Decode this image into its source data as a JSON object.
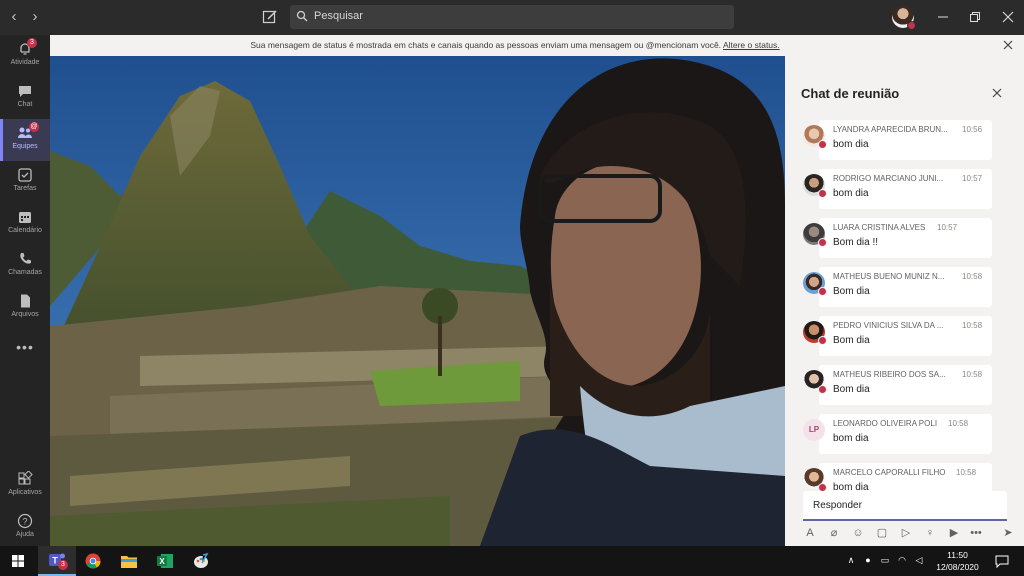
{
  "search": {
    "placeholder": "Pesquisar"
  },
  "rail": [
    {
      "label": "Atividade",
      "icon": "bell-icon",
      "badge": "3"
    },
    {
      "label": "Chat",
      "icon": "chat-icon",
      "badge": ""
    },
    {
      "label": "Equipes",
      "icon": "teams-icon",
      "badge": "@"
    },
    {
      "label": "Tarefas",
      "icon": "tasks-icon",
      "badge": ""
    },
    {
      "label": "Calendário",
      "icon": "calendar-icon",
      "badge": ""
    },
    {
      "label": "Chamadas",
      "icon": "phone-icon",
      "badge": ""
    },
    {
      "label": "Arquivos",
      "icon": "file-icon",
      "badge": ""
    }
  ],
  "rail_bottom": [
    {
      "label": "Aplicativos",
      "icon": "apps-icon"
    },
    {
      "label": "Ajuda",
      "icon": "help-icon"
    }
  ],
  "banner": {
    "message": "Sua mensagem de status é mostrada em chats e canais quando as pessoas enviam uma mensagem ou @mencionam você.",
    "link": "Altere o status."
  },
  "chat": {
    "title": "Chat de reunião",
    "messages": [
      {
        "name": "LYANDRA APARECIDA BRUN...",
        "time": "10:56",
        "text": "bom dia",
        "avatar": "photo"
      },
      {
        "name": "RODRIGO MARCIANO JUNI...",
        "time": "10:57",
        "text": "bom dia",
        "avatar": "photo"
      },
      {
        "name": "LUARA CRISTINA ALVES",
        "time": "10:57",
        "text": "Bom dia !!",
        "avatar": "photo"
      },
      {
        "name": "MATHEUS BUENO MUNIZ N...",
        "time": "10:58",
        "text": "Bom dia",
        "avatar": "photo"
      },
      {
        "name": "PEDRO VINICIUS SILVA DA ...",
        "time": "10:58",
        "text": "Bom dia",
        "avatar": "photo"
      },
      {
        "name": "MATHEUS RIBEIRO DOS SA...",
        "time": "10:58",
        "text": "Bom dia",
        "avatar": "photo"
      },
      {
        "name": "LEONARDO OLIVEIRA POLI",
        "time": "10:58",
        "text": "bom dia",
        "avatar": "initials",
        "initials": "LP"
      },
      {
        "name": "MARCELO CAPORALLI FILHO",
        "time": "10:58",
        "text": "bom dia",
        "avatar": "photo"
      }
    ],
    "reply_placeholder": "Responder"
  },
  "taskbar": {
    "teams_badge": "3",
    "time": "11:50",
    "date": "12/08/2020"
  },
  "colors": {
    "accent": "#6264a7",
    "presence_busy": "#c4314b"
  }
}
